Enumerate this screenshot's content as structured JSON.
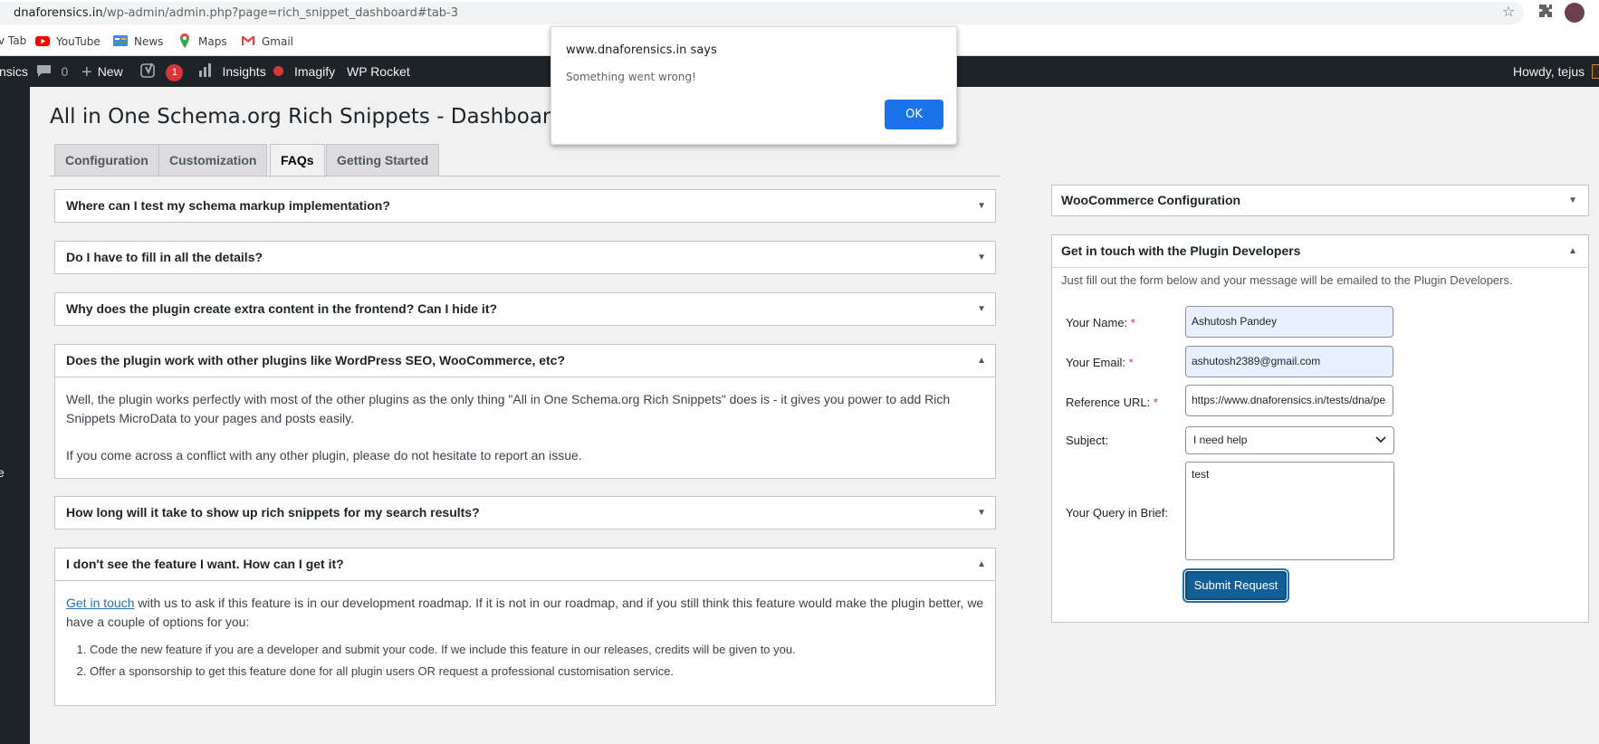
{
  "browser": {
    "url_host": "dnaforensics.in",
    "url_path": "/wp-admin/admin.php?page=rich_snippet_dashboard#tab-3",
    "icons": [
      "star-icon",
      "extensions-icon",
      "profile-avatar"
    ]
  },
  "bookmarks": [
    {
      "label": "v Tab",
      "icon": "none"
    },
    {
      "label": "YouTube",
      "icon": "youtube-icon"
    },
    {
      "label": "News",
      "icon": "news-icon"
    },
    {
      "label": "Maps",
      "icon": "maps-icon"
    },
    {
      "label": "Gmail",
      "icon": "gmail-icon"
    }
  ],
  "adminbar": {
    "site": "nsics",
    "comments": "0",
    "new": "New",
    "yoast_badge": "1",
    "insights": "Insights",
    "imagify": "Imagify",
    "wprocket": "WP Rocket",
    "howdy": "Howdy, tejus"
  },
  "sidebar_fragment": "e",
  "page_title": "All in One Schema.org Rich Snippets - Dashboard",
  "tabs": [
    {
      "label": "Configuration",
      "active": false
    },
    {
      "label": "Customization",
      "active": false
    },
    {
      "label": "FAQs",
      "active": true
    },
    {
      "label": "Getting Started",
      "active": false
    }
  ],
  "faqs": [
    {
      "question": "Where can I test my schema markup implementation?",
      "open": false
    },
    {
      "question": "Do I have to fill in all the details?",
      "open": false
    },
    {
      "question": "Why does the plugin create extra content in the frontend? Can I hide it?",
      "open": false
    },
    {
      "question": "Does the plugin work with other plugins like WordPress SEO, WooCommerce, etc?",
      "open": true,
      "p1": "Well, the plugin works perfectly with most of the other plugins as the only thing \"All in One Schema.org Rich Snippets\" does is - it gives you power to add Rich Snippets MicroData to your pages and posts easily.",
      "p2": "If you come across a conflict with any other plugin, please do not hesitate to report an issue."
    },
    {
      "question": "How long will it take to show up rich snippets for my search results?",
      "open": false
    },
    {
      "question": "I don't see the feature I want. How can I get it?",
      "open": true,
      "link": "Get in touch",
      "p1_rest": " with us to ask if this feature is in our development roadmap. If it is not in our roadmap, and if you still think this feature would make the plugin better, we have a couple of options for you:",
      "li1": "Code the new feature if you are a developer and submit your code. If we include this feature in our releases, credits will be given to you.",
      "li2": "Offer a sponsorship to get this feature done for all plugin users OR request a professional customisation service."
    }
  ],
  "woo_box": {
    "title": "WooCommerce Configuration"
  },
  "contact_box": {
    "title": "Get in touch with the Plugin Developers",
    "intro": "Just fill out the form below and your message will be emailed to the Plugin Developers.",
    "name_label": "Your Name:",
    "name_value": "Ashutosh Pandey",
    "email_label": "Your Email:",
    "email_value": "ashutosh2389@gmail.com",
    "url_label": "Reference URL:",
    "url_value": "https://www.dnaforensics.in/tests/dna/pe",
    "subject_label": "Subject:",
    "subject_value": "I need help",
    "query_label": "Your Query in Brief:",
    "query_value": "test",
    "required_mark": "*",
    "submit": "Submit Request"
  },
  "dialog": {
    "title": "www.dnaforensics.in says",
    "message": "Something went wrong!",
    "ok": "OK"
  }
}
